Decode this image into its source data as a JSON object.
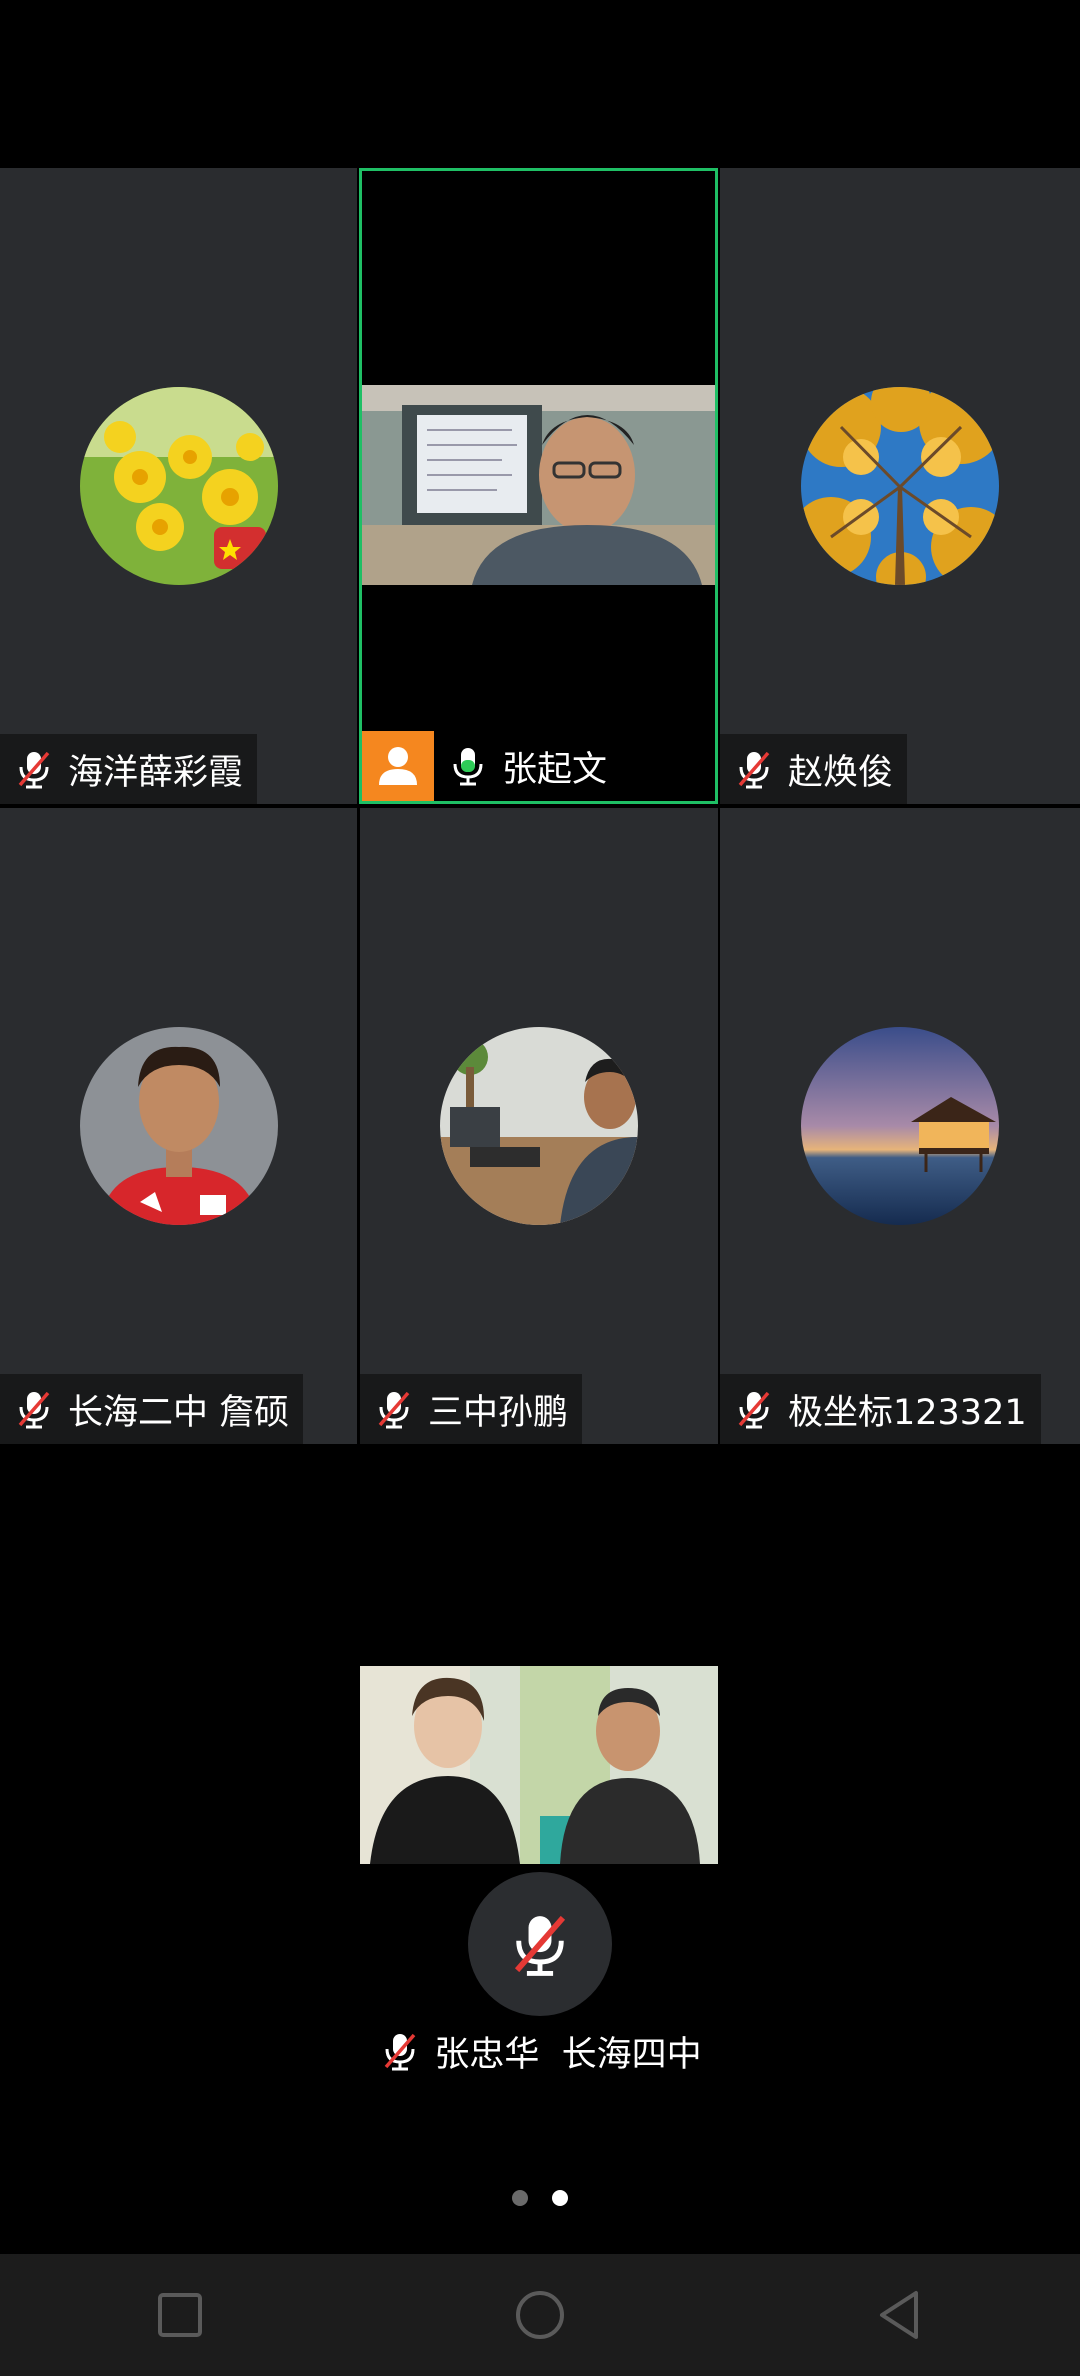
{
  "grid": {
    "tiles": [
      {
        "name": "海洋薛彩霞",
        "mic": "muted"
      },
      {
        "name": "张起文",
        "mic": "active",
        "host": true
      },
      {
        "name": "赵焕俊",
        "mic": "muted"
      },
      {
        "name": "长海二中 詹硕",
        "mic": "muted"
      },
      {
        "name": "三中孙鹏",
        "mic": "muted"
      },
      {
        "name": "极坐标123321",
        "mic": "muted"
      }
    ]
  },
  "self": {
    "name": "张忠华  长海四中",
    "mic": "muted"
  },
  "pager": {
    "pages": 2,
    "current": 2
  },
  "nav": {
    "icons": [
      "recent-apps-icon",
      "home-icon",
      "back-icon"
    ]
  },
  "colors": {
    "active_border": "#1fbf65",
    "host_badge": "#f5871f",
    "tile_bg": "#2a2c2f",
    "mute_slash": "#e53935"
  }
}
